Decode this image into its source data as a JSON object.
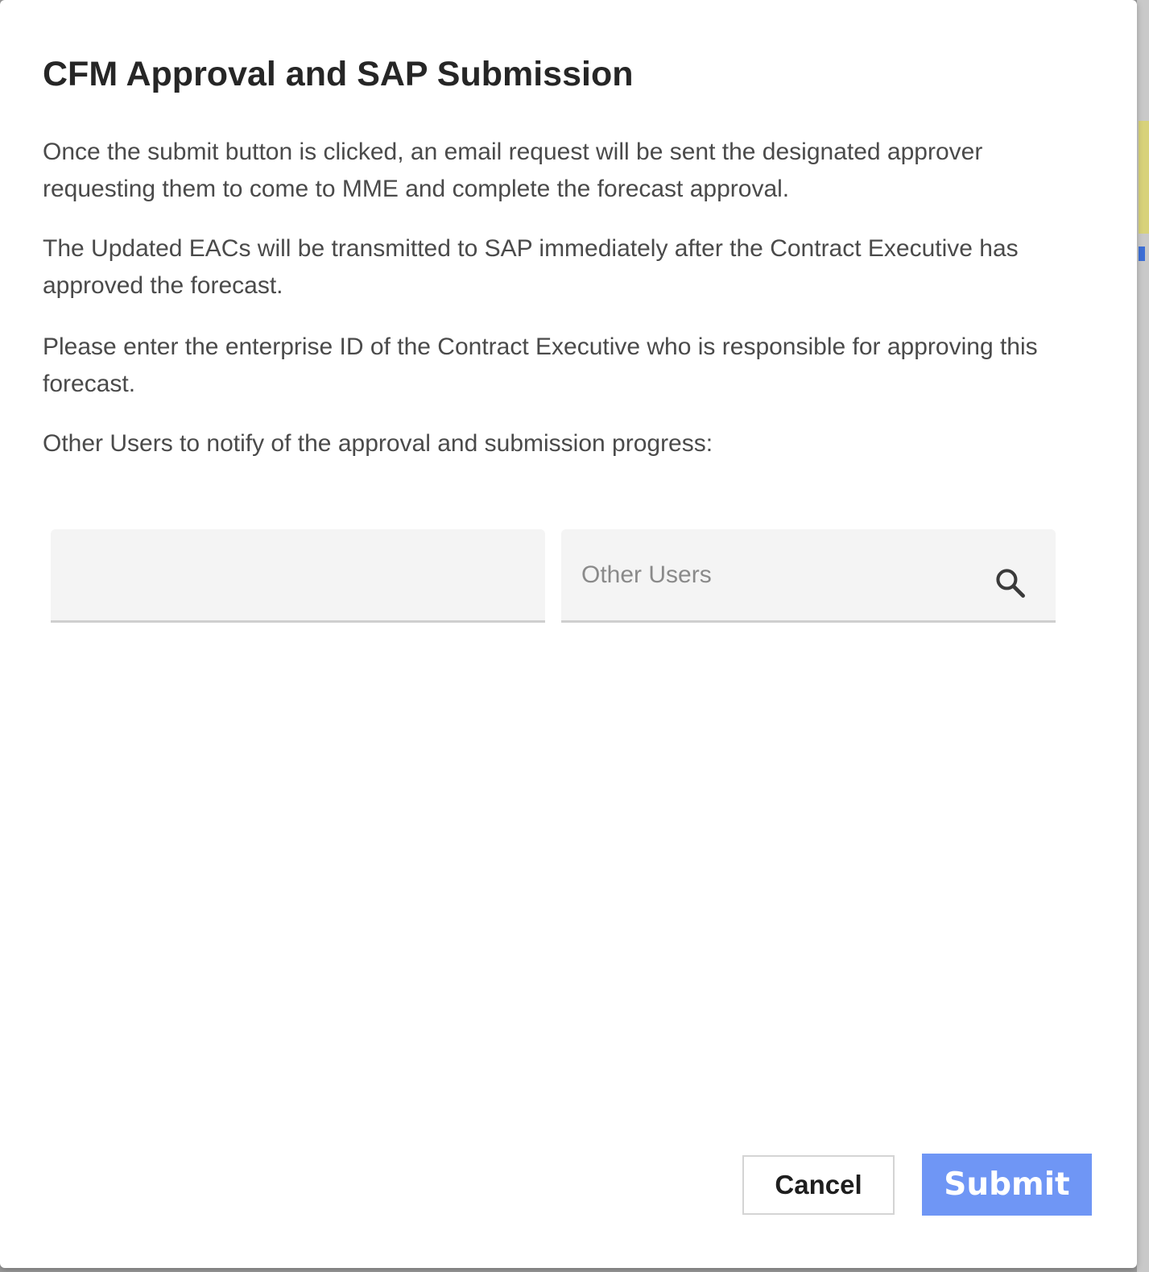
{
  "dialog": {
    "title": "CFM Approval and SAP Submission",
    "paragraphs": [
      "Once the submit button is clicked, an email request will be sent the designated approver requesting them to come to MME and complete the forecast approval.",
      "The Updated EACs will be transmitted to SAP immediately after the Contract Executive has approved the forecast.",
      "Please enter the enterprise ID of the Contract Executive who is responsible for approving this forecast.",
      "Other Users to notify of the approval and submission progress:"
    ],
    "approver_field": {
      "value": "",
      "placeholder": ""
    },
    "other_users_field": {
      "value": "",
      "placeholder": "Other Users",
      "icon": "search-icon"
    },
    "buttons": {
      "cancel_label": "Cancel",
      "submit_label": "Submit"
    }
  },
  "colors": {
    "primary": "#6f96f5",
    "field_background": "#f4f4f4",
    "title_text": "#262626",
    "body_text": "#4a4a4a"
  }
}
